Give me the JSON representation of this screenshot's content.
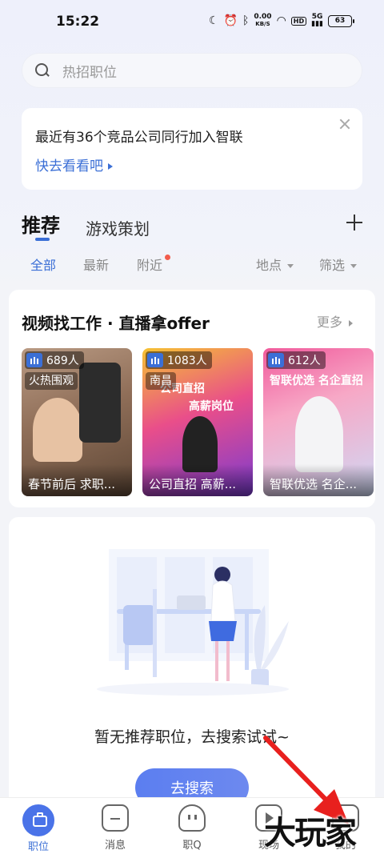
{
  "status": {
    "time": "15:22",
    "net_speed": "0.00",
    "net_unit": "KB/S",
    "hd": "HD",
    "signal": "5G",
    "battery": "63"
  },
  "search": {
    "placeholder": "热招职位"
  },
  "promo": {
    "text": "最近有36个竞品公司同行加入智联",
    "link": "快去看看吧"
  },
  "tabs": {
    "primary": "推荐",
    "secondary": "游戏策划"
  },
  "filters": {
    "all": "全部",
    "latest": "最新",
    "nearby": "附近",
    "location": "地点",
    "filter": "筛选"
  },
  "video_section": {
    "title": "视频找工作 · 直播拿offer",
    "more": "更多",
    "cards": [
      {
        "viewers": "689人",
        "tag": "火热围观",
        "caption": "春节前后 求职..."
      },
      {
        "viewers": "1083人",
        "tag": "南昌",
        "banner_line1": "公司直招",
        "banner_line2": "高薪岗位",
        "caption": "公司直招 高薪..."
      },
      {
        "viewers": "612人",
        "banner": "智联优选 名企直招",
        "caption": "智联优选 名企..."
      }
    ]
  },
  "empty": {
    "message": "暂无推荐职位，去搜索试试~",
    "button": "去搜索"
  },
  "nav": {
    "jobs": "职位",
    "messages": "消息",
    "jobq": "职Q",
    "live": "现场",
    "mine": "我的"
  },
  "watermark": "大玩家",
  "colors": {
    "accent": "#3b6fd6",
    "cta": "#5b7ef0",
    "arrow": "#e8201e"
  }
}
